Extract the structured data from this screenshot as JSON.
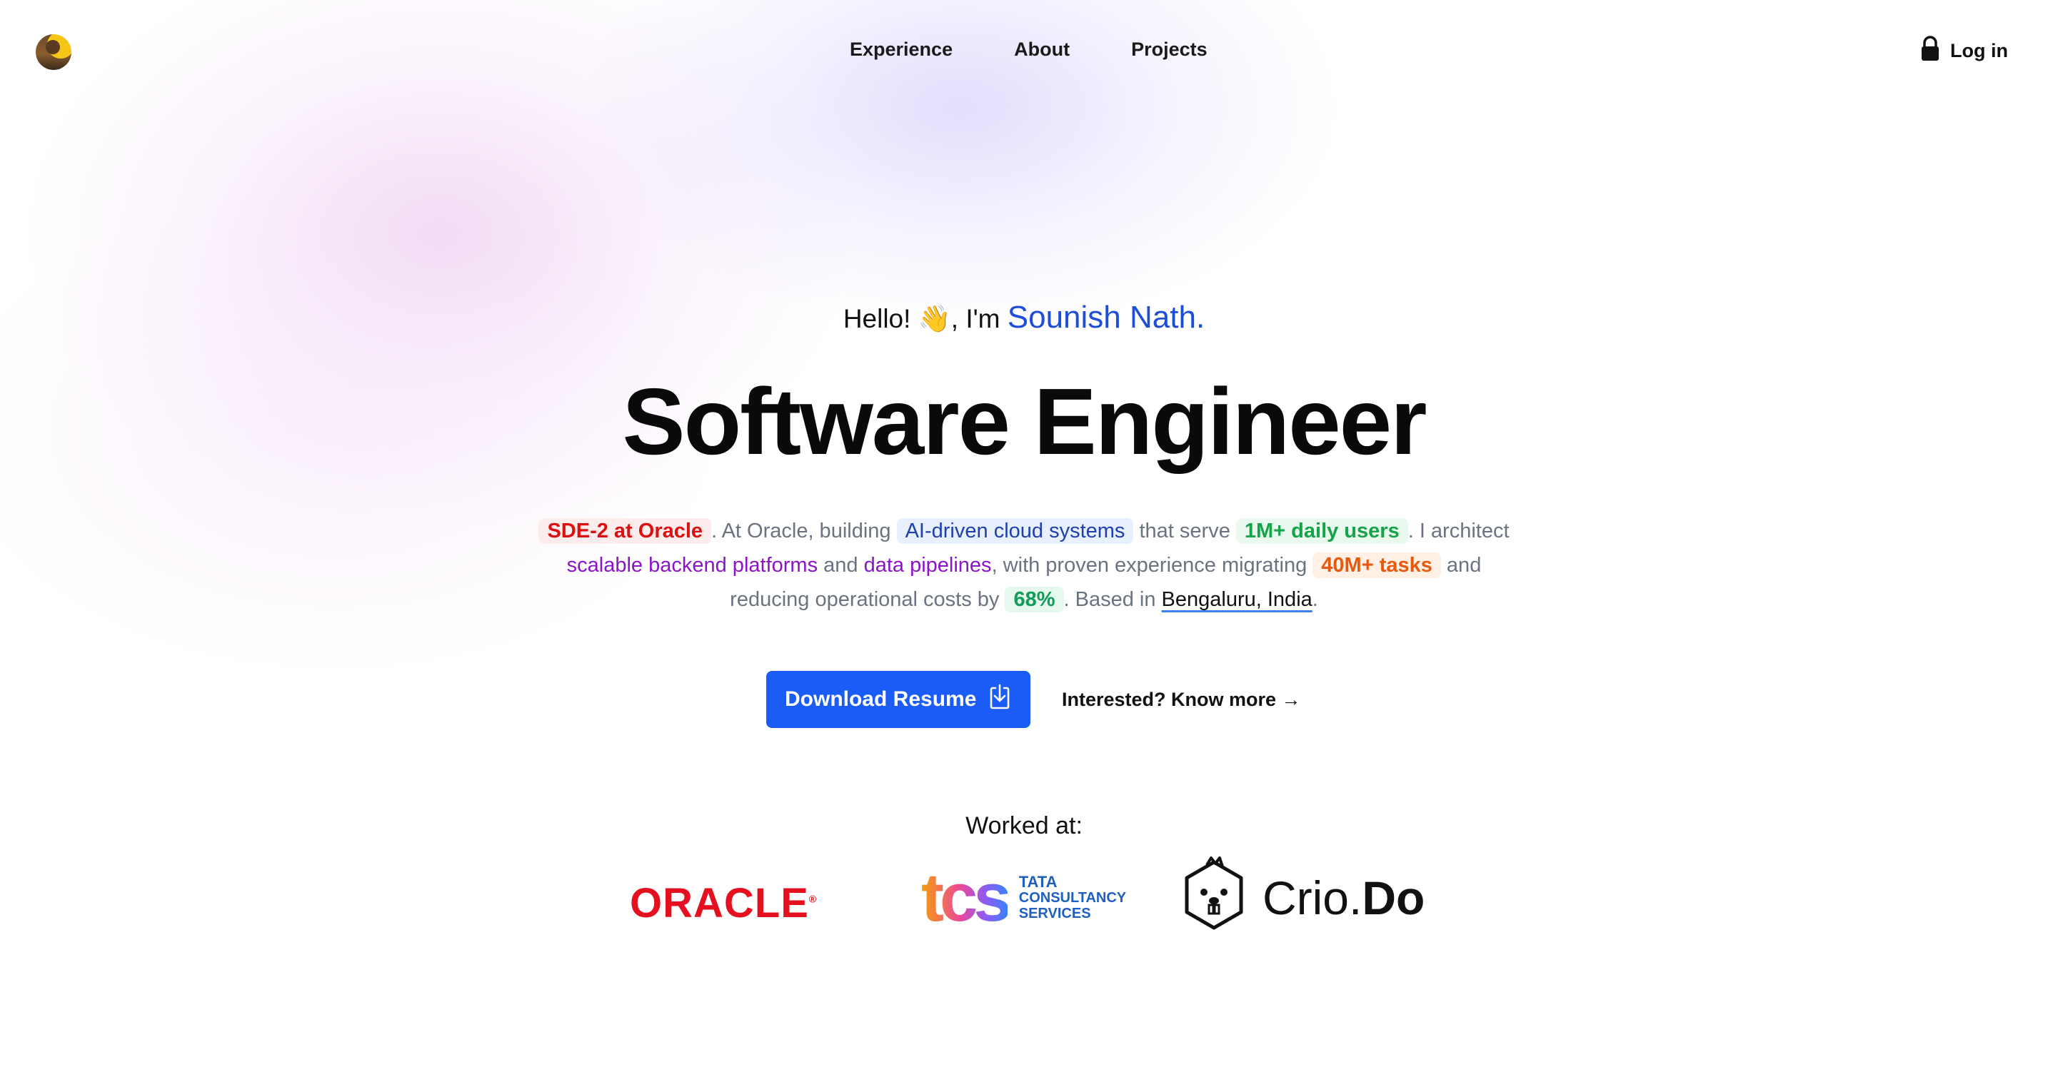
{
  "nav": {
    "items": [
      {
        "label": "Experience"
      },
      {
        "label": "About"
      },
      {
        "label": "Projects"
      }
    ],
    "login_label": "Log in",
    "login_icon": "lock-icon"
  },
  "hero": {
    "greeting_prefix": "Hello! 👋, I'm ",
    "name": "Sounish Nath.",
    "title": "Software Engineer",
    "description": {
      "p1": "SDE-2 at Oracle",
      "p2": ". At Oracle, building ",
      "p3": "AI-driven cloud systems",
      "p4": " that serve ",
      "p5": "1M+ daily users",
      "p6": ". I architect ",
      "p7": "scalable backend platforms",
      "p8": " and ",
      "p9": "data pipelines",
      "p10": ", with proven experience migrating ",
      "p11": "40M+ tasks",
      "p12": " and reducing operational costs by ",
      "p13": "68%",
      "p14": ". Based in ",
      "p15": "Bengaluru, India",
      "p16": "."
    }
  },
  "cta": {
    "download_label": "Download Resume",
    "download_icon": "download-icon",
    "know_more_label": "Interested? Know more →"
  },
  "worked_at": {
    "label": "Worked at:",
    "companies": [
      {
        "name": "ORACLE",
        "mark": "®"
      },
      {
        "mark": "tcs",
        "line1": "TATA",
        "line2": "CONSULTANCY",
        "line3": "SERVICES"
      },
      {
        "name_a": "Crio.",
        "name_b": "Do"
      }
    ]
  },
  "colors": {
    "accent": "#1a5cf5",
    "name_blue": "#1d4ed8",
    "oracle_red": "#e4101f",
    "highlight_red": "#dc1010",
    "highlight_green": "#16a34a",
    "highlight_orange": "#ea580c",
    "highlight_purple": "#8b14c9"
  }
}
